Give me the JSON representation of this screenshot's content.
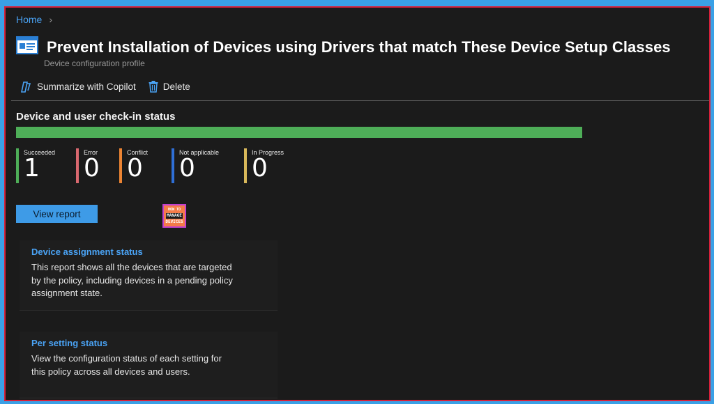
{
  "breadcrumb": {
    "home": "Home",
    "separator": "›"
  },
  "header": {
    "title": "Prevent Installation of Devices using Drivers that match These Device Setup Classes",
    "subtitle": "Device configuration profile",
    "icon": "config-profile-icon"
  },
  "toolbar": {
    "copilot_label": "Summarize with Copilot",
    "copilot_icon": "copilot-icon",
    "delete_label": "Delete",
    "delete_icon": "trash-icon"
  },
  "checkin": {
    "title": "Device and user check-in status",
    "progress_fraction": 1.0,
    "progress_color": "#4eae58",
    "stats": [
      {
        "label": "Succeeded",
        "value": "1",
        "color": "#4eae58"
      },
      {
        "label": "Error",
        "value": "0",
        "color": "#d9686f"
      },
      {
        "label": "Conflict",
        "value": "0",
        "color": "#ec8433"
      },
      {
        "label": "Not applicable",
        "value": "0",
        "color": "#2f6fd6"
      },
      {
        "label": "In Progress",
        "value": "0",
        "color": "#d8b85a"
      }
    ]
  },
  "actions": {
    "view_report": "View report"
  },
  "logo": {
    "line1": "HOW TO",
    "line2": "MANAGE",
    "line3": "DEVICES"
  },
  "cards": [
    {
      "link": "Device assignment status",
      "text": "This report shows all the devices that are targeted by the policy, including devices in a pending policy assignment state."
    },
    {
      "link": "Per setting status",
      "text": "View the configuration status of each setting for this policy across all devices and users."
    }
  ],
  "colors": {
    "accent": "#3e9be7",
    "link": "#4aa3f5",
    "frame_border": "#d6203a",
    "background": "#1b1b1b"
  }
}
